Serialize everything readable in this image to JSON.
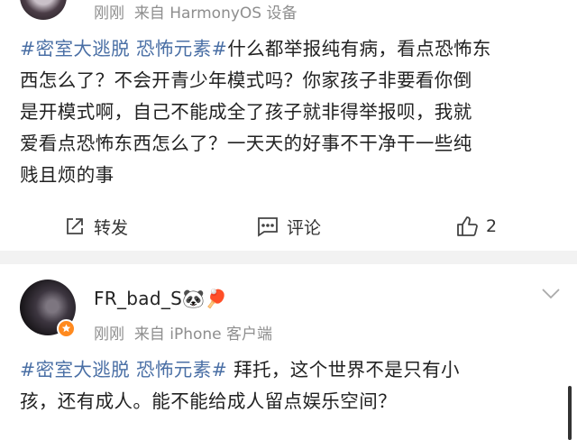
{
  "post1": {
    "meta_time": "刚刚",
    "meta_source": "来自",
    "meta_device": "HarmonyOS 设备",
    "tag1": "#密室大逃脱",
    "tag2": "恐怖元素#",
    "line1_rest": "什么都举报纯有病，看点恐怖东",
    "line2": "西怎么了？不会开青少年模式吗？你家孩子非要看你倒",
    "line3": "是开模式啊，自己不能成全了孩子就非得举报呗，我就",
    "line4": "爱看点恐怖东西怎么了？一天天的好事不干净干一些纯",
    "line5": "贱且烦的事",
    "actions": {
      "repost_label": "转发",
      "comment_label": "评论",
      "like_count": "2"
    }
  },
  "post2": {
    "username": "FR_bad_S",
    "username_emoji": "🐼🏓",
    "meta_time": "刚刚",
    "meta_source": "来自",
    "meta_device": "iPhone 客户端",
    "tag1": "#密室大逃脱",
    "tag2": "恐怖元素#",
    "line1_rest": " 拜托，这个世界不是只有小",
    "line2": "孩，还有成人。能不能给成人留点娱乐空间？"
  },
  "colors": {
    "topic_link": "#4a6fa5",
    "meta_gray": "#8e8e8e",
    "badge_orange": "#ff8a1f"
  }
}
